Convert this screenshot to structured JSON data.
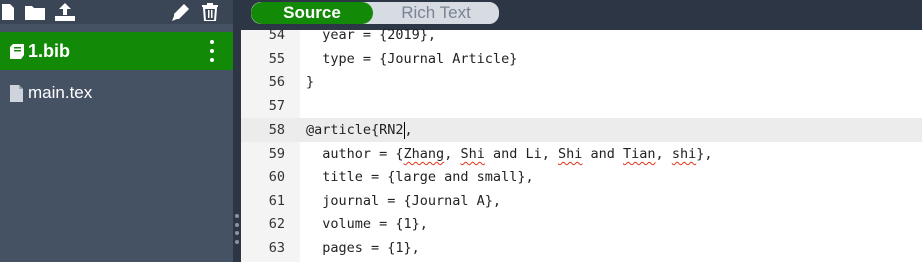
{
  "sidebar": {
    "files": [
      {
        "name": "1.bib",
        "active": true
      },
      {
        "name": "main.tex",
        "active": false
      }
    ]
  },
  "toggle": {
    "source_label": "Source",
    "rich_label": "Rich Text"
  },
  "editor": {
    "lines": [
      {
        "num": "54",
        "text": "  year = {2019},"
      },
      {
        "num": "55",
        "text": "  type = {Journal Article}"
      },
      {
        "num": "56",
        "text": "}"
      },
      {
        "num": "57",
        "text": ""
      },
      {
        "num": "58",
        "text_before_caret": "@article{RN2",
        "text_after_caret": ","
      },
      {
        "num": "59",
        "parts": [
          "  author = {",
          "Zhang",
          ", ",
          "Shi",
          " and Li, ",
          "Shi",
          " and ",
          "Tian",
          ", ",
          "shi",
          "},"
        ]
      },
      {
        "num": "60",
        "text": "  title = {large and small},"
      },
      {
        "num": "61",
        "text": "  journal = {Journal A},"
      },
      {
        "num": "62",
        "text": "  volume = {1},"
      },
      {
        "num": "63",
        "text": "  pages = {1},"
      }
    ]
  },
  "colors": {
    "accent": "#138a07",
    "sidebar_bg": "#455264",
    "toolbar_bg": "#2c3645"
  }
}
